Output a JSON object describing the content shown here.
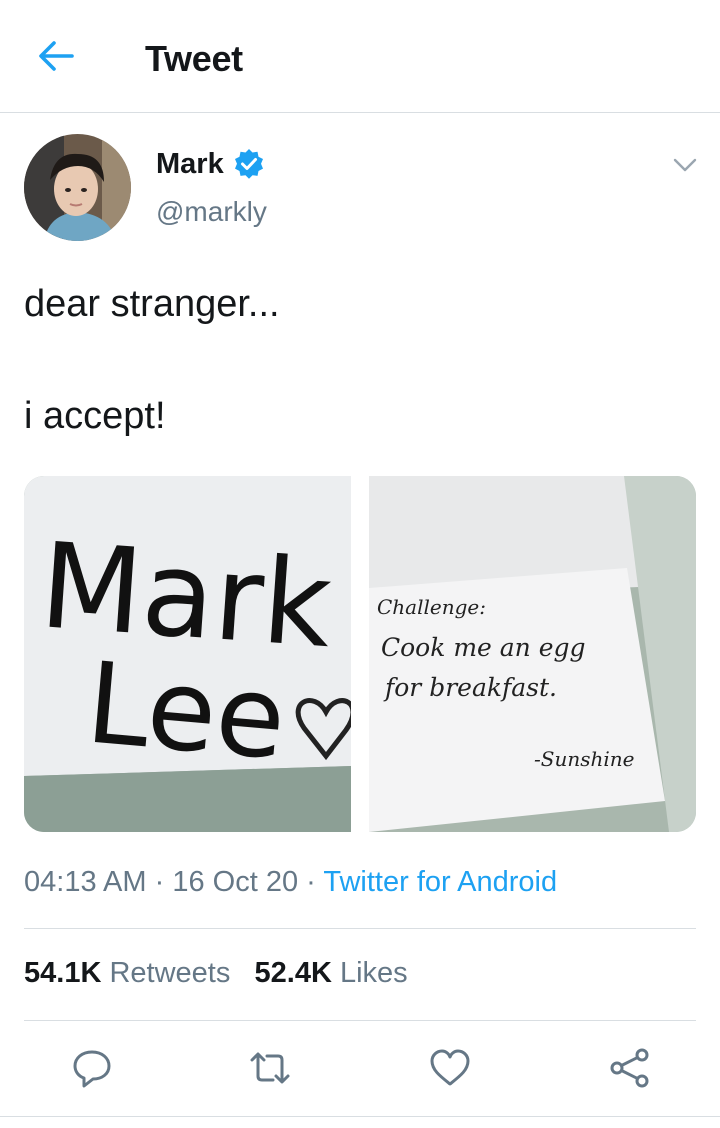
{
  "header": {
    "title": "Tweet",
    "back_icon": "arrow-left-icon"
  },
  "author": {
    "name": "Mark",
    "handle": "@markly",
    "verified": true,
    "verified_icon": "verified-badge-icon"
  },
  "tweet": {
    "lines": [
      "dear stranger...",
      "i accept!"
    ],
    "media": [
      {
        "description_icon": "photo",
        "handwritten": [
          "Mark",
          "Lee"
        ]
      },
      {
        "description_icon": "photo",
        "note": [
          "Challenge:",
          "Cook me an egg",
          "for breakfast.",
          "-Sunshine"
        ]
      }
    ],
    "time": "04:13 AM",
    "date": "16 Oct 20",
    "separator": "·",
    "source": "Twitter for Android"
  },
  "stats": {
    "retweets_count": "54.1K",
    "retweets_label": "Retweets",
    "likes_count": "52.4K",
    "likes_label": "Likes"
  },
  "actions": [
    "reply-icon",
    "retweet-icon",
    "like-icon",
    "share-icon"
  ],
  "colors": {
    "accent": "#1da1f2",
    "secondary_text": "#657786",
    "divider": "#d9dee2"
  }
}
